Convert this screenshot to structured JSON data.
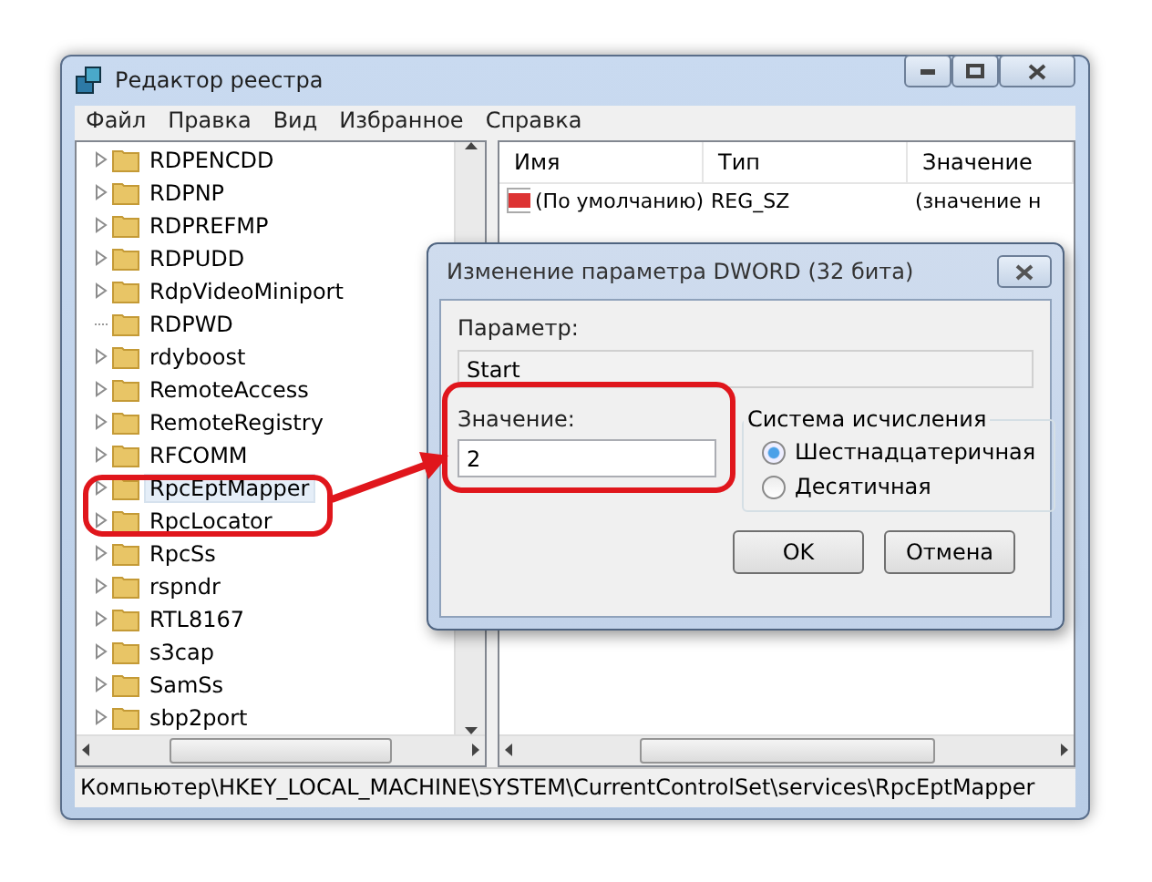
{
  "window": {
    "title": "Редактор реестра"
  },
  "menu": [
    "Файл",
    "Правка",
    "Вид",
    "Избранное",
    "Справка"
  ],
  "tree": [
    {
      "label": "RDPENCDD",
      "expandable": true,
      "selected": false
    },
    {
      "label": "RDPNP",
      "expandable": true,
      "selected": false
    },
    {
      "label": "RDPREFMP",
      "expandable": true,
      "selected": false
    },
    {
      "label": "RDPUDD",
      "expandable": true,
      "selected": false
    },
    {
      "label": "RdpVideoMiniport",
      "expandable": true,
      "selected": false
    },
    {
      "label": "RDPWD",
      "expandable": false,
      "selected": false
    },
    {
      "label": "rdyboost",
      "expandable": true,
      "selected": false
    },
    {
      "label": "RemoteAccess",
      "expandable": true,
      "selected": false
    },
    {
      "label": "RemoteRegistry",
      "expandable": true,
      "selected": false
    },
    {
      "label": "RFCOMM",
      "expandable": true,
      "selected": false
    },
    {
      "label": "RpcEptMapper",
      "expandable": true,
      "selected": true
    },
    {
      "label": "RpcLocator",
      "expandable": true,
      "selected": false
    },
    {
      "label": "RpcSs",
      "expandable": true,
      "selected": false
    },
    {
      "label": "rspndr",
      "expandable": true,
      "selected": false
    },
    {
      "label": "RTL8167",
      "expandable": true,
      "selected": false
    },
    {
      "label": "s3cap",
      "expandable": true,
      "selected": false
    },
    {
      "label": "SamSs",
      "expandable": true,
      "selected": false
    },
    {
      "label": "sbp2port",
      "expandable": true,
      "selected": false
    }
  ],
  "list": {
    "columns": [
      "Имя",
      "Тип",
      "Значение"
    ],
    "rows": [
      {
        "name": "(По умолчанию)",
        "type": "REG_SZ",
        "value": "(значение н"
      }
    ]
  },
  "status_bar": "Компьютер\\HKEY_LOCAL_MACHINE\\SYSTEM\\CurrentControlSet\\services\\RpcEptMapper",
  "dialog": {
    "title": "Изменение параметра DWORD (32 бита)",
    "name_label": "Параметр:",
    "name_value": "Start",
    "value_label": "Значение:",
    "value": "2",
    "base_group": "Система исчисления",
    "bases": [
      {
        "label": "Шестнадцатеричная",
        "selected": true
      },
      {
        "label": "Десятичная",
        "selected": false
      }
    ],
    "buttons": [
      "OK",
      "Отмена"
    ]
  }
}
